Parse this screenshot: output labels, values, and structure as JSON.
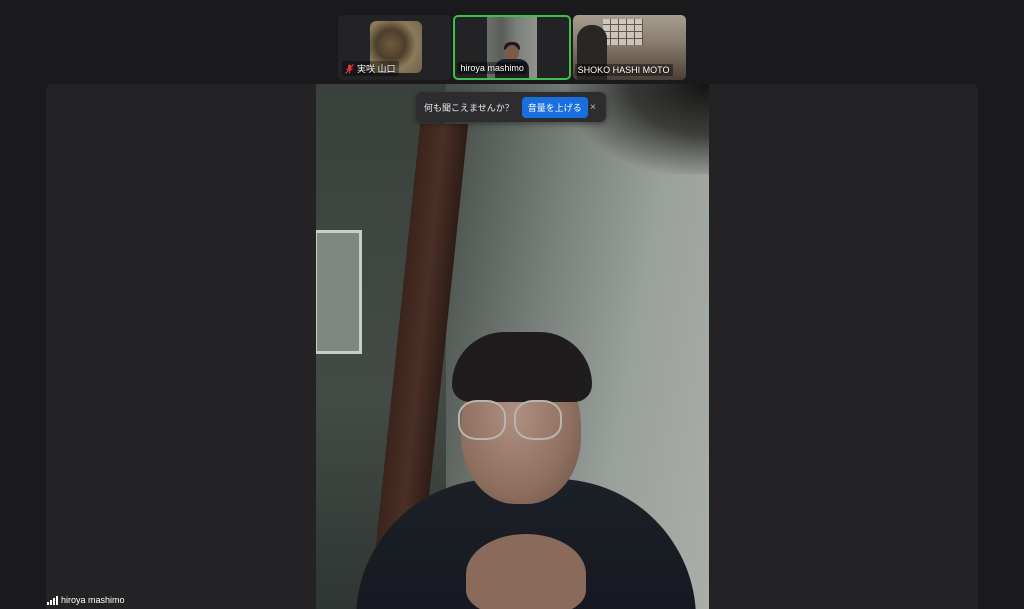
{
  "participants": [
    {
      "name": "実咲 山口",
      "muted": true
    },
    {
      "name": "hiroya mashimo",
      "active_speaker": true
    },
    {
      "name": "SHOKO HASHI MOTO"
    }
  ],
  "audio_prompt": {
    "message": "何も聞こえませんか？",
    "button_label": "音量を上げる",
    "close_glyph": "×"
  },
  "main_video": {
    "speaker_name": "hiroya mashimo"
  },
  "colors": {
    "accent_blue": "#1a6fe0",
    "active_border": "#3fbf4e",
    "mute_red": "#e53935",
    "background": "#1a1a1c"
  }
}
